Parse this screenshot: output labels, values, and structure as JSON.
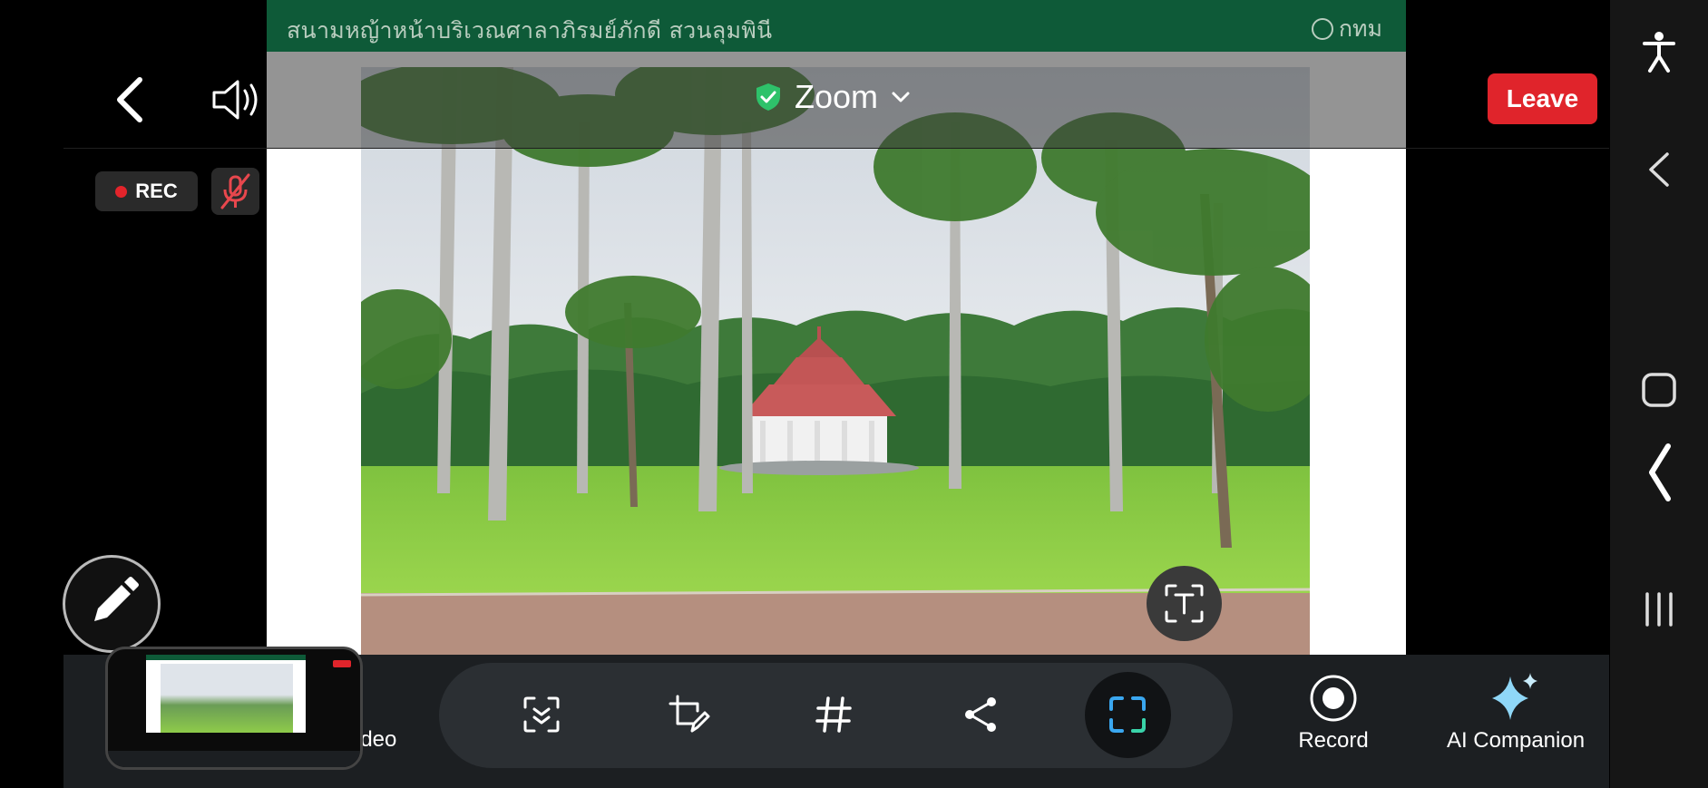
{
  "share": {
    "banner_title": "สนามหญ้าหน้าบริเวณศาลาภิรมย์ภักดี สวนลุมพินี",
    "banner_logo_text": "กทม"
  },
  "meeting": {
    "title": "Zoom",
    "leave_label": "Leave",
    "rec_label": "REC"
  },
  "toolbar": {
    "video_label": "ideo",
    "record_label": "Record",
    "ai_label": "AI Companion"
  },
  "colors": {
    "leave_red": "#e0242b",
    "banner_green": "#0e5a38",
    "shield_green": "#2ec26a",
    "toolbar_bg": "#1c1f22"
  },
  "icons": [
    "back-arrow-icon",
    "speaker-icon",
    "shield-check-icon",
    "chevron-down-icon",
    "mic-muted-icon",
    "pen-icon",
    "scan-icon",
    "edit-crop-icon",
    "hash-icon",
    "share-icon",
    "fullscreen-icon",
    "text-ocr-icon",
    "record-icon",
    "sparkle-icon",
    "accessibility-icon",
    "nav-back-icon",
    "home-icon",
    "recents-icon",
    "edge-handle-icon"
  ]
}
